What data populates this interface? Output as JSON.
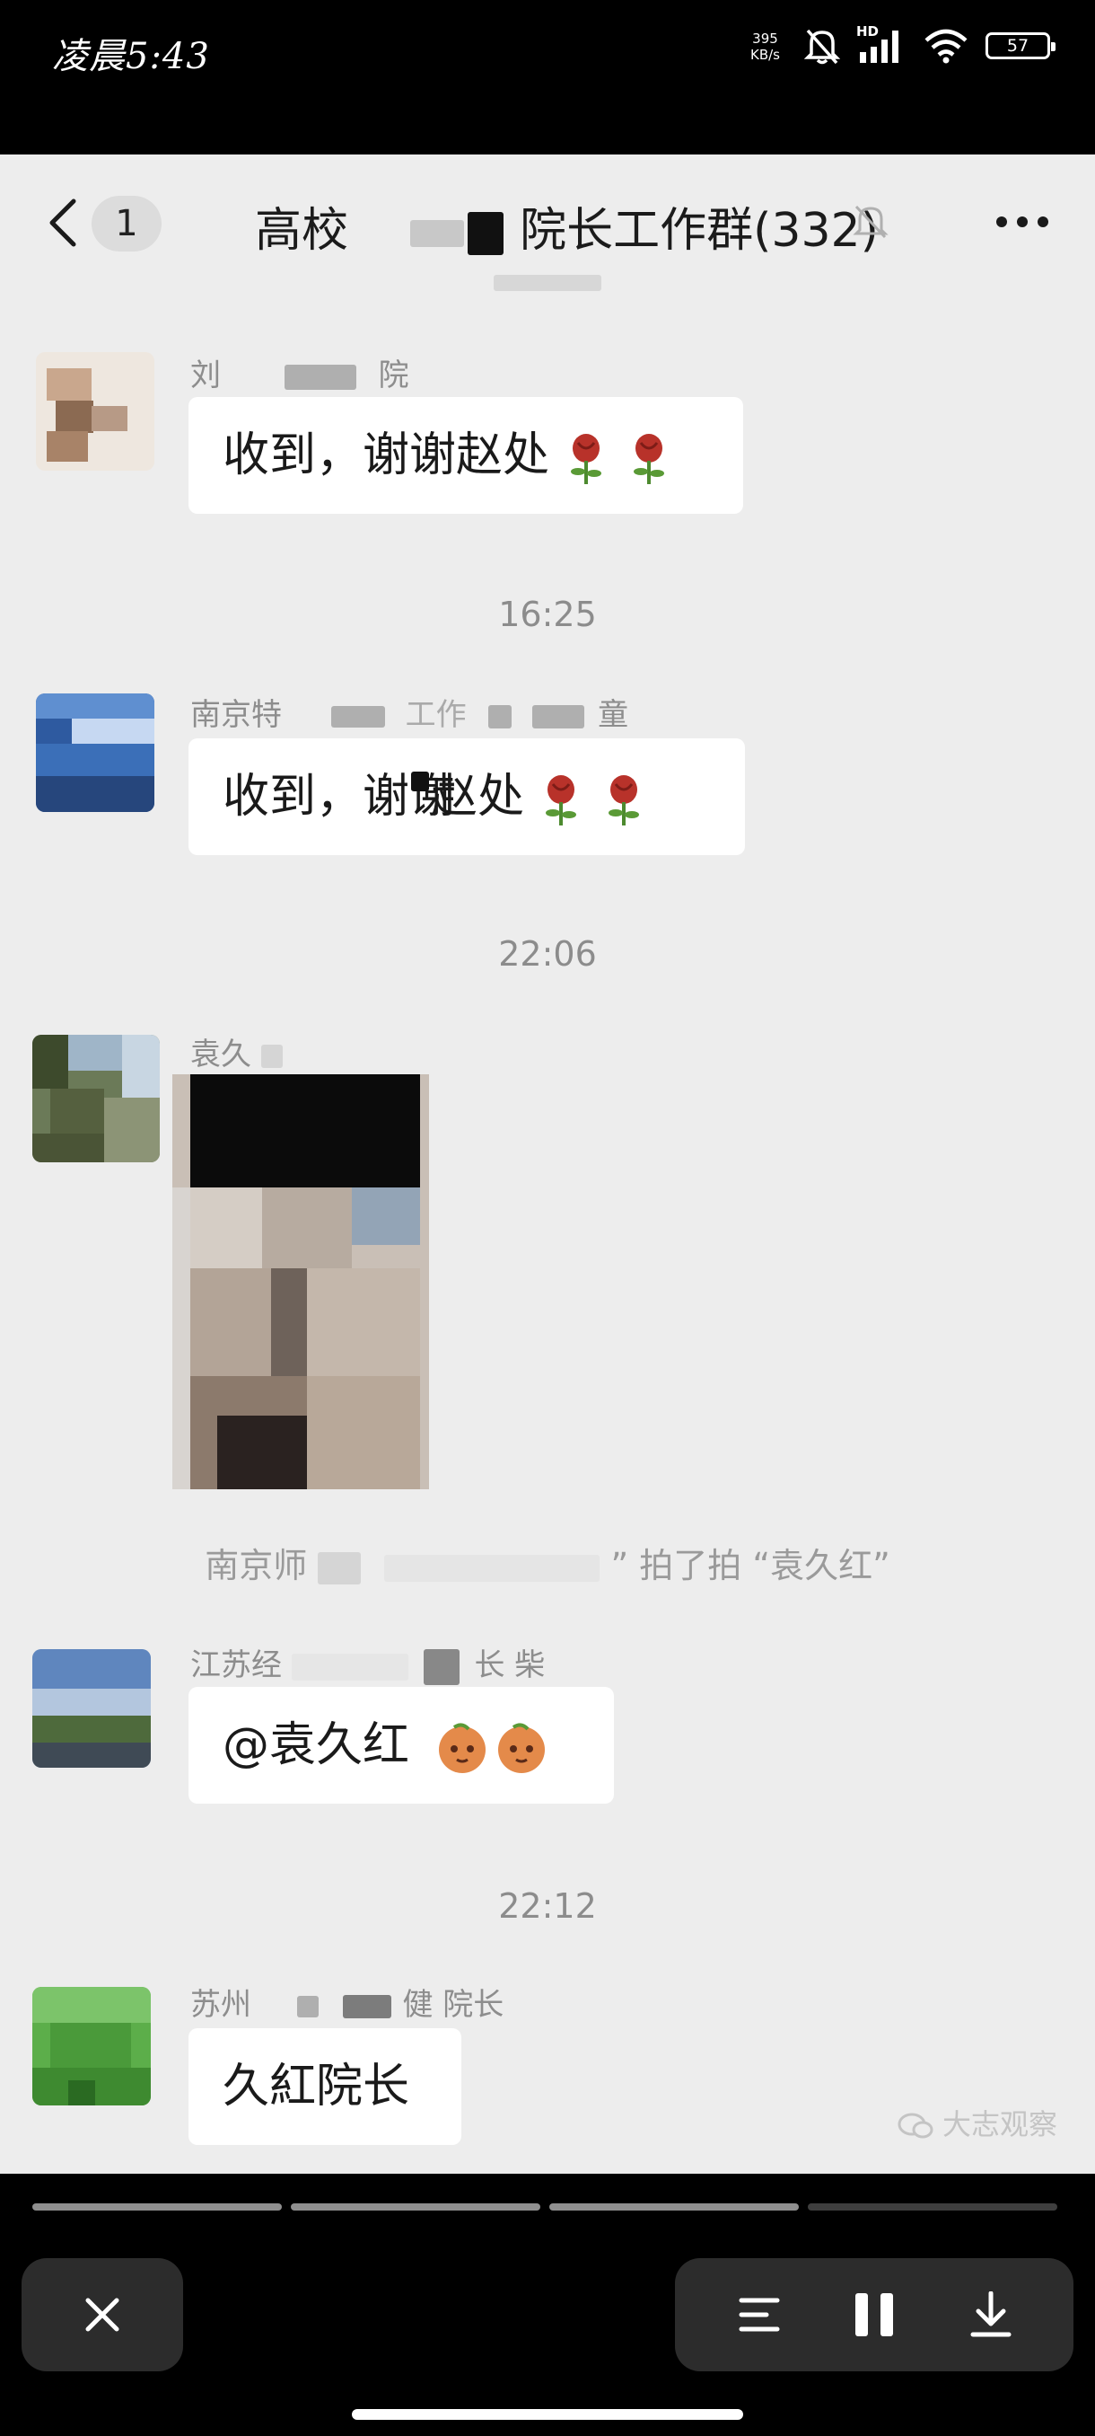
{
  "status_bar": {
    "time": "凌晨5:43",
    "net_speed_value": "395",
    "net_speed_unit": "KB/s",
    "network_label": "HD",
    "battery": "57"
  },
  "header": {
    "unread_count": "1",
    "title_prefix": "高校",
    "title_suffix": "院长工作群(332)"
  },
  "messages": {
    "m1": {
      "sender_a": "刘",
      "sender_b": "院",
      "text": "收到，谢谢赵处"
    },
    "t1": "16:25",
    "m2": {
      "sender_a": "南京特",
      "sender_b": "工作",
      "sender_c": "童",
      "text_a": "收到，谢谢",
      "text_b": "赵处"
    },
    "t2": "22:06",
    "m3": {
      "sender": "袁久"
    },
    "system": {
      "prefix": "南京师",
      "middle": "” 拍了拍 “袁久红”"
    },
    "m4": {
      "sender_a": "江苏经",
      "sender_b": "长 柴",
      "text": "@袁久红"
    },
    "t3": "22:12",
    "m5": {
      "sender_a": "苏州",
      "sender_b": "健 院长",
      "text": "久紅院长"
    }
  },
  "watermark": "大志观察",
  "colors": {
    "chat_bg": "#ededed",
    "bubble_bg": "#ffffff",
    "timestamp": "#8c8c8c",
    "overlay_bg": "#000000",
    "control_bg": "#2c2c2c"
  },
  "icons": {
    "back": "chevron-left-icon",
    "mute": "bell-off-icon",
    "more": "more-dots-icon",
    "close": "close-icon",
    "menu": "list-icon",
    "pause": "pause-icon",
    "download": "download-icon"
  }
}
